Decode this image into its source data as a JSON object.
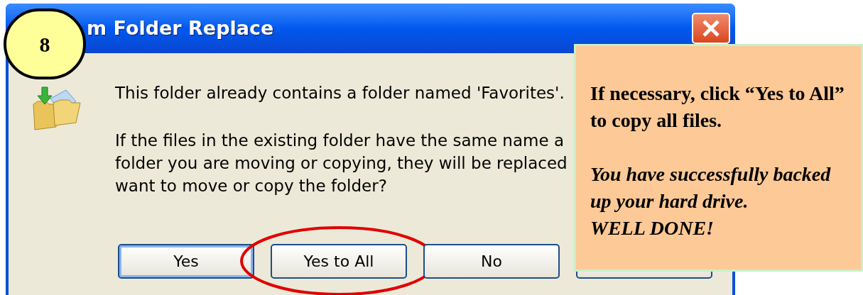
{
  "dialog": {
    "title": "m Folder Replace",
    "message_lines": [
      "This folder already contains a folder named 'Favorites'.",
      "If the files in the existing folder have the same name a",
      "folder you are moving or copying, they will be replaced",
      "want to move or copy the folder?"
    ],
    "buttons": [
      {
        "label": "Yes",
        "default": true,
        "circled": false
      },
      {
        "label": "Yes to All",
        "default": false,
        "circled": true
      },
      {
        "label": "No",
        "default": false,
        "circled": false
      }
    ]
  },
  "step_badge": {
    "label": "8"
  },
  "callout": {
    "paragraphs": [
      {
        "text": "If necessary, click “Yes to All” to copy all files.",
        "kind": "instruction"
      },
      {
        "text": "You have successfully backed up your hard drive.",
        "kind": "conclusion"
      },
      {
        "text": "WELL DONE!",
        "kind": "conclusion"
      }
    ]
  }
}
